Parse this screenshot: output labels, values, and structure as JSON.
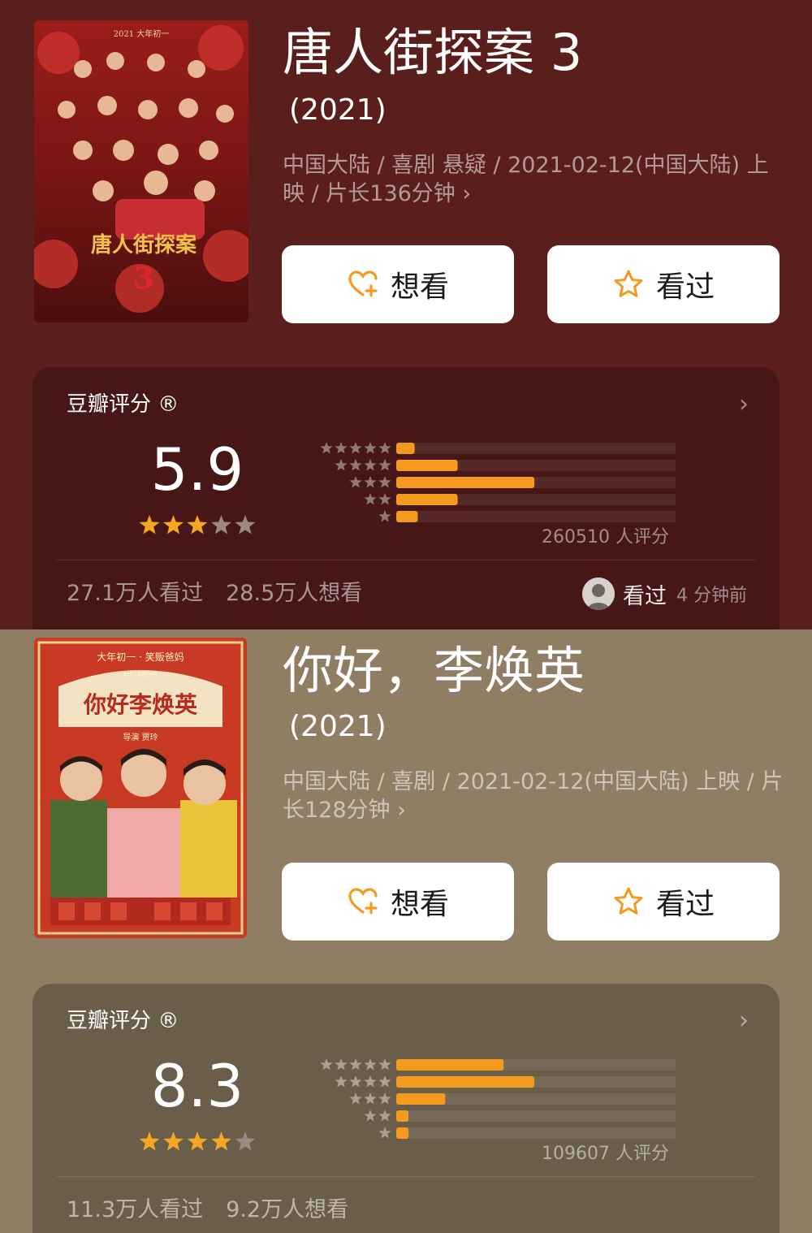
{
  "colors": {
    "accent_bar": "#f39a1f",
    "star_on": "#f5a623",
    "star_off": "#9a8a86",
    "heart_icon": "#f39a1f",
    "section_0_bg": "#5a1e1d",
    "section_1_bg": "#8f7e64"
  },
  "movies": [
    {
      "poster_icon": "movie-poster",
      "title": "唐人街探案 3",
      "year": "(2021)",
      "meta": "中国大陆 / 喜剧 悬疑 / 2021-02-12(中国大陆) 上映 / 片长136分钟 ›",
      "want_label": "想看",
      "seen_label": "看过",
      "rating_title": "豆瓣评分 ®",
      "score": "5.9",
      "stars_value": 3,
      "distribution": [
        0.06,
        0.2,
        0.45,
        0.2,
        0.07
      ],
      "rating_count": "260510 人评分",
      "watched": "27.1万人看过",
      "wish": "28.5万人想看",
      "activity_label": "看过",
      "activity_time": "4 分钟前"
    },
    {
      "poster_icon": "movie-poster",
      "title": "你好，李焕英",
      "year": "(2021)",
      "meta": "中国大陆 / 喜剧 / 2021-02-12(中国大陆) 上映 / 片长128分钟 ›",
      "want_label": "想看",
      "seen_label": "看过",
      "rating_title": "豆瓣评分 ®",
      "score": "8.3",
      "stars_value": 4,
      "distribution": [
        0.35,
        0.45,
        0.16,
        0.04,
        0.04
      ],
      "rating_count": "109607 人评分",
      "watched": "11.3万人看过",
      "wish": "9.2万人想看"
    }
  ]
}
